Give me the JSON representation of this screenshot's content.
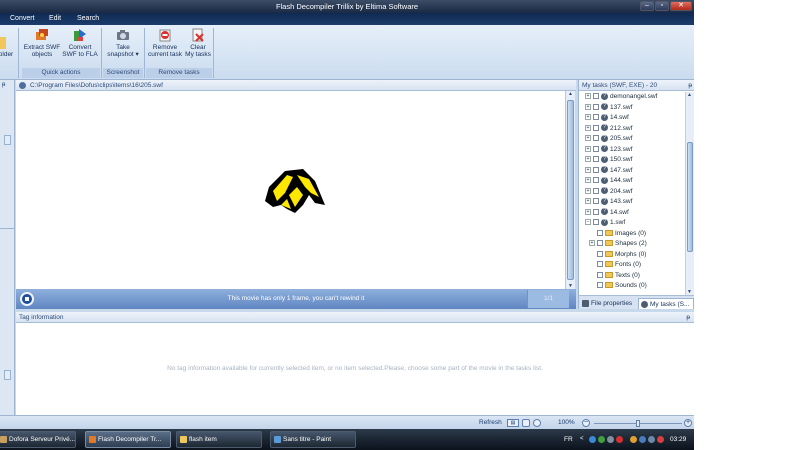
{
  "window": {
    "title": "Flash Decompiler Trillix by Eltima Software",
    "controls": {
      "minimize": "–",
      "maximize": "▫",
      "close": "✕"
    }
  },
  "menu": [
    "Convert",
    "Edit",
    "Search"
  ],
  "ribbon": {
    "partial_left_label": "older",
    "buttons": [
      {
        "label": "Extract SWF\nobjects",
        "icon": "extract-icon"
      },
      {
        "label": "Convert\nSWF to FLA",
        "icon": "convert-icon"
      },
      {
        "label": "Take\nsnapshot ▾",
        "icon": "camera-icon"
      },
      {
        "label": "Remove\ncurrent task",
        "icon": "remove-icon"
      },
      {
        "label": "Clear\nMy tasks",
        "icon": "clear-icon"
      }
    ],
    "groups": [
      "Quick actions",
      "Screenshot",
      "Remove tasks"
    ]
  },
  "path_bar": {
    "path": "C:\\Program Files\\Dofus\\clips\\items\\16\\205.swf"
  },
  "player": {
    "message": "This movie has only 1 frame, you can't rewind it",
    "frame_counter": "1/1"
  },
  "tasks_pane": {
    "header": "My tasks (SWF, EXE) - 20",
    "pin": "ᵽ",
    "files": [
      "demonangel.swf",
      "137.swf",
      "14.swf",
      "212.swf",
      "205.swf",
      "123.swf",
      "150.swf",
      "147.swf",
      "144.swf",
      "204.swf",
      "143.swf",
      "14.swf",
      "1.swf"
    ],
    "children": [
      "Images (0)",
      "Shapes (2)",
      "Morphs (0)",
      "Fonts (0)",
      "Texts (0)",
      "Sounds (0)"
    ],
    "tabs": [
      "File properties",
      "My tasks (S..."
    ]
  },
  "tag_info": {
    "header": "Tag information",
    "message": "No tag information available for currently selected item, or no item selected.Please, choose some part of the movie in the tasks list."
  },
  "status_bar": {
    "refresh": "Refresh",
    "zoom": "100%",
    "zoom_minus": "−",
    "zoom_plus": "+",
    "zoom_level": 0.5
  },
  "taskbar": {
    "items": [
      "Dofora Serveur Privé...",
      "Flash Decompiler Tr...",
      "flash item",
      "Sans titre - Paint"
    ],
    "language": "FR",
    "clock": "03:29"
  },
  "colors": {
    "title_bar": "#1a2a44",
    "ribbon": "#dbe6f4",
    "player_bar": "#6f93ca",
    "taskbar": "#0b121c"
  }
}
